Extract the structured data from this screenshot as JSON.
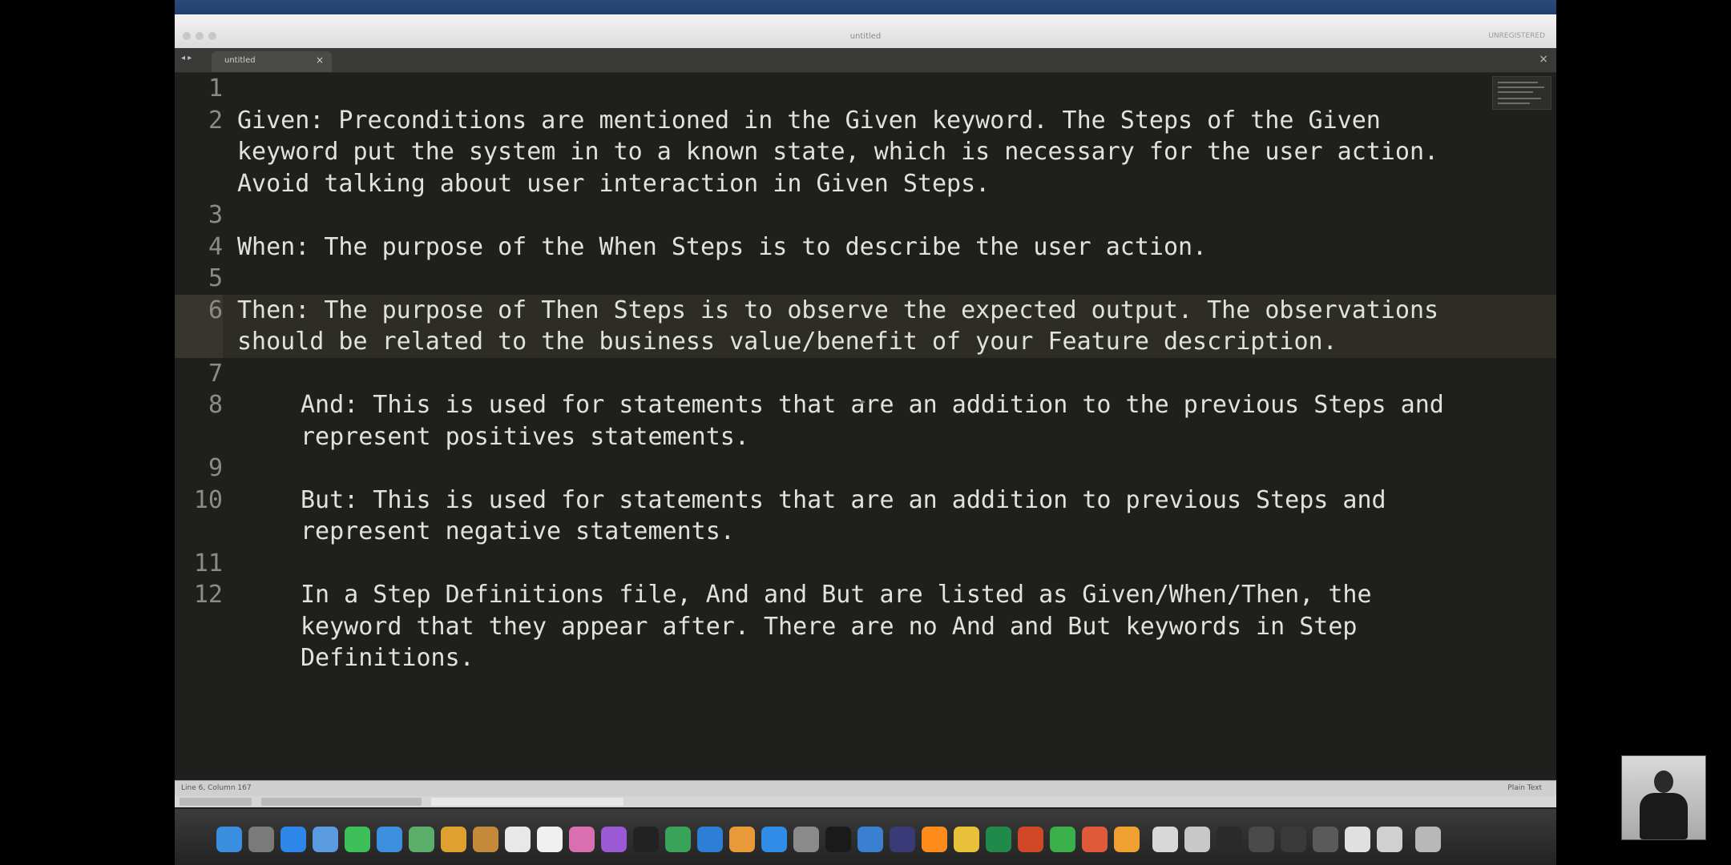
{
  "window": {
    "title": "untitled",
    "right_note": "UNREGISTERED"
  },
  "tab": {
    "label": "untitled",
    "close_glyph": "×",
    "arrows_glyph": "◂ ▸"
  },
  "editor": {
    "lines": [
      {
        "num": "1",
        "text": "",
        "indent": false,
        "active": false
      },
      {
        "num": "2",
        "text": "Given: Preconditions are mentioned in the Given keyword. The Steps of the Given keyword put the system in to a known state, which is necessary for the user action. Avoid talking about user interaction in Given Steps.",
        "indent": false,
        "active": false
      },
      {
        "num": "3",
        "text": "",
        "indent": false,
        "active": false
      },
      {
        "num": "4",
        "text": "When: The purpose of the When Steps is to describe the user action.",
        "indent": false,
        "active": false
      },
      {
        "num": "5",
        "text": "",
        "indent": false,
        "active": false
      },
      {
        "num": "6",
        "text": "Then: The purpose of Then Steps is to observe the expected output. The observations should be related to the business value/benefit of your Feature description.",
        "indent": false,
        "active": true
      },
      {
        "num": "7",
        "text": "",
        "indent": false,
        "active": false
      },
      {
        "num": "8",
        "text": "And: This is used for statements that are an addition to the previous Steps and represent positives statements.",
        "indent": true,
        "active": false
      },
      {
        "num": "9",
        "text": "",
        "indent": false,
        "active": false
      },
      {
        "num": "10",
        "text": "But: This is used for statements that are an addition to previous Steps and represent negative statements.",
        "indent": true,
        "active": false
      },
      {
        "num": "11",
        "text": "",
        "indent": false,
        "active": false
      },
      {
        "num": "12",
        "text": "In a Step Definitions file, And and But are listed as Given/When/Then, the keyword that they appear after. There are no And and But keywords in Step Definitions.",
        "indent": true,
        "active": false
      }
    ]
  },
  "statusbar": {
    "left": "Line 6, Column 167",
    "right": "Plain Text"
  },
  "dock": {
    "icons": [
      {
        "name": "finder-icon",
        "color": "#3b8fe0"
      },
      {
        "name": "launchpad-icon",
        "color": "#7a7a7a"
      },
      {
        "name": "safari-icon",
        "color": "#2d87e8"
      },
      {
        "name": "notes-icon",
        "color": "#5a9be0"
      },
      {
        "name": "messages-icon",
        "color": "#3fbf5a"
      },
      {
        "name": "mail-icon",
        "color": "#3f8fe0"
      },
      {
        "name": "maps-icon",
        "color": "#5caf6a"
      },
      {
        "name": "chrome-icon",
        "color": "#e0a030"
      },
      {
        "name": "folder-icon",
        "color": "#c48a3a"
      },
      {
        "name": "calendar-icon",
        "color": "#e8e8e8"
      },
      {
        "name": "reminders-icon",
        "color": "#f0f0f0"
      },
      {
        "name": "photos-icon",
        "color": "#d86fb0"
      },
      {
        "name": "podcasts-icon",
        "color": "#9b59d6"
      },
      {
        "name": "tv-icon",
        "color": "#222222"
      },
      {
        "name": "numbers-icon",
        "color": "#3aa35a"
      },
      {
        "name": "keynote-icon",
        "color": "#2e7dd6"
      },
      {
        "name": "pages-icon",
        "color": "#e89a3a"
      },
      {
        "name": "appstore-icon",
        "color": "#2f8de8"
      },
      {
        "name": "settings-icon",
        "color": "#8a8a8a"
      },
      {
        "name": "terminal-icon",
        "color": "#1a1a1a"
      },
      {
        "name": "xcode-icon",
        "color": "#3a7fd0"
      },
      {
        "name": "eclipse-icon",
        "color": "#3a3a78"
      },
      {
        "name": "sublime-icon",
        "color": "#ff8c1a"
      },
      {
        "name": "chrome-canary-icon",
        "color": "#e8c03a"
      },
      {
        "name": "excel-icon",
        "color": "#1f8a4a"
      },
      {
        "name": "powerpoint-icon",
        "color": "#d24726"
      },
      {
        "name": "camtasia-icon",
        "color": "#3ab04a"
      },
      {
        "name": "browser-icon",
        "color": "#e05a3a"
      },
      {
        "name": "orange-app-icon",
        "color": "#f0a030"
      },
      {
        "name": "window-thumb-icon",
        "color": "#d8d8d8"
      },
      {
        "name": "window-thumb-icon",
        "color": "#c8c8c8"
      },
      {
        "name": "window-thumb-icon",
        "color": "#2a2a2a"
      },
      {
        "name": "window-thumb-icon",
        "color": "#4a4a4a"
      },
      {
        "name": "window-thumb-icon",
        "color": "#3a3a3a"
      },
      {
        "name": "window-thumb-icon",
        "color": "#5a5a5a"
      },
      {
        "name": "window-thumb-icon",
        "color": "#e0e0e0"
      },
      {
        "name": "window-thumb-icon",
        "color": "#d0d0d0"
      },
      {
        "name": "trash-icon",
        "color": "#b8b8b8"
      }
    ]
  }
}
